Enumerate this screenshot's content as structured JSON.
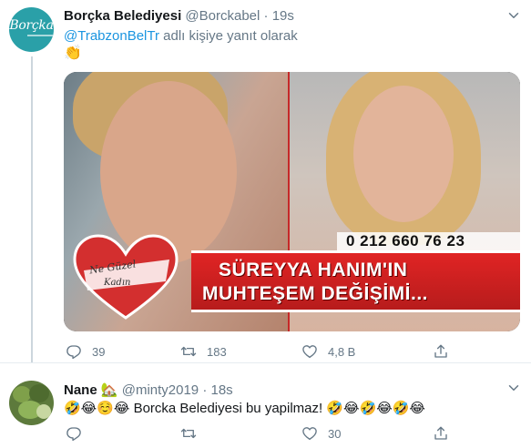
{
  "tweets": [
    {
      "author_name": "Borçka Belediyesi",
      "handle": "@Borckabel",
      "separator": "·",
      "time": "19s",
      "avatar_text": "Borçka",
      "more_icon": "more-icon",
      "reply_prefix": "@TrabzonBelTr",
      "reply_suffix": " adlı kişiye yanıt olarak",
      "text": "👏",
      "media": {
        "phone": "0 212 660 76 23",
        "banner_line1": "SÜREYYA HANIM'IN",
        "banner_line2": "MUHTEŞEM DEĞİŞİMİ...",
        "heart_line1": "Ne Güzel",
        "heart_line2": "Kadın"
      },
      "actions": {
        "reply_count": "39",
        "retweet_count": "183",
        "like_count": "4,8 B",
        "share_count": ""
      }
    },
    {
      "author_name": "Nane",
      "name_emoji": "🏡",
      "handle": "@minty2019",
      "separator": "·",
      "time": "18s",
      "more_icon": "more-icon",
      "text": "🤣😂☺️😂 Borcka Belediyesi bu yapilmaz! 🤣😂🤣😂🤣😂",
      "actions": {
        "reply_count": "",
        "retweet_count": "",
        "like_count": "30",
        "share_count": ""
      }
    }
  ],
  "colors": {
    "link": "#1b95e0",
    "muted": "#657786",
    "text": "#14171a",
    "thread_line": "#ccd6dd",
    "banner_red": "#e02424"
  }
}
